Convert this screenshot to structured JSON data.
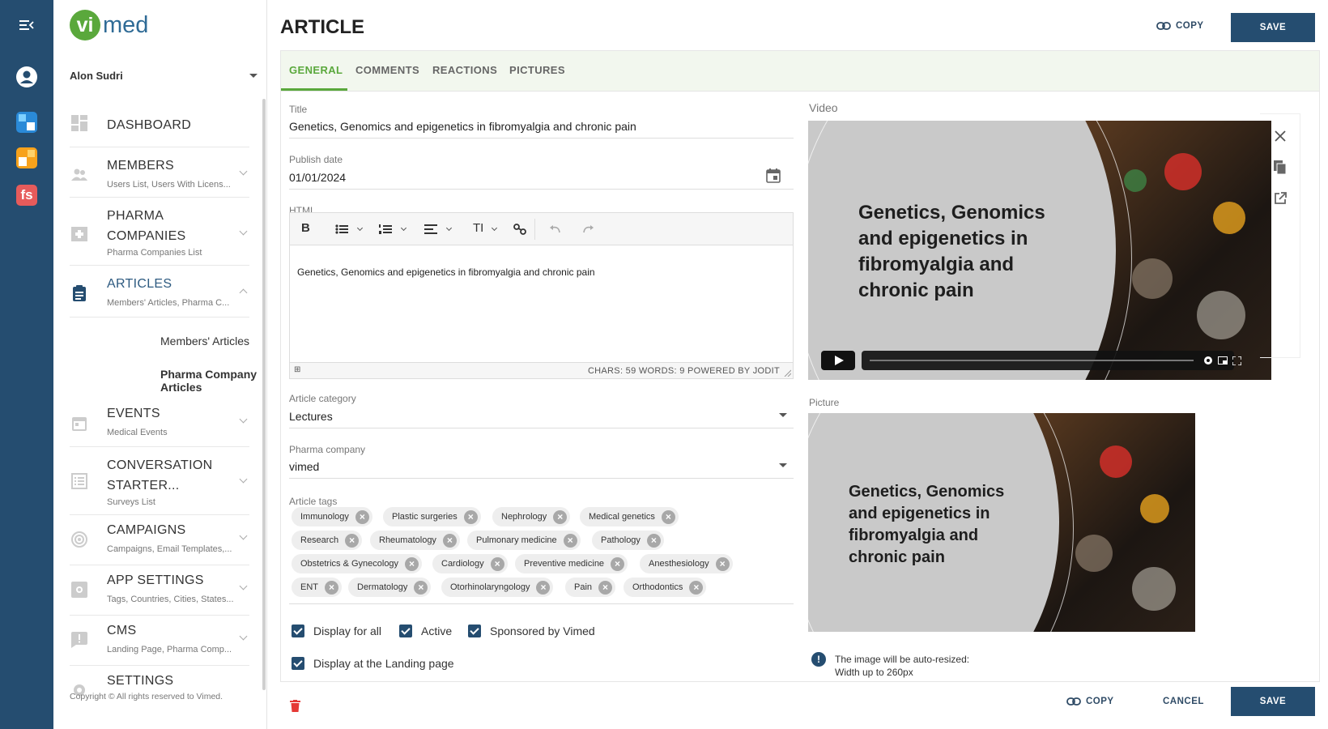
{
  "sidebar": {
    "logo_vi": "vi",
    "logo_med": "med",
    "user_name": "Alon Sudri",
    "items": [
      {
        "label": "DASHBOARD",
        "sub": "",
        "icon": "dashboard-icon"
      },
      {
        "label": "MEMBERS",
        "sub": "Users List, Users With Licens...",
        "icon": "people-icon"
      },
      {
        "label": "PHARMA COMPANIES",
        "sub": "Pharma Companies List",
        "icon": "pharma-icon"
      },
      {
        "label": "ARTICLES",
        "sub": "Members' Articles, Pharma C...",
        "icon": "clipboard-icon"
      },
      {
        "label": "EVENTS",
        "sub": "Medical Events",
        "icon": "calendar-icon"
      },
      {
        "label": "CONVERSATION STARTER...",
        "sub": "Surveys List",
        "icon": "list-icon"
      },
      {
        "label": "CAMPAIGNS",
        "sub": "Campaigns, Email Templates,...",
        "icon": "campaign-icon"
      },
      {
        "label": "APP SETTINGS",
        "sub": "Tags, Countries, Cities, States...",
        "icon": "settings-box-icon"
      },
      {
        "label": "CMS",
        "sub": "Landing Page, Pharma Comp...",
        "icon": "alert-box-icon"
      },
      {
        "label": "SETTINGS",
        "sub": "",
        "icon": "gear-icon"
      }
    ],
    "articles_sub": [
      "Members' Articles",
      "Pharma Company Articles"
    ],
    "copyright": "Copyright © All rights reserved to Vimed."
  },
  "header": {
    "title": "ARTICLE",
    "copy_label": "COPY",
    "save_label": "SAVE"
  },
  "tabs": [
    "GENERAL",
    "COMMENTS",
    "REACTIONS",
    "PICTURES"
  ],
  "form": {
    "title_label": "Title",
    "title_value": "Genetics, Genomics and epigenetics in fibromyalgia and chronic pain",
    "publish_label": "Publish date",
    "publish_value": "01/01/2024",
    "html_label": "HTML",
    "html_content": "Genetics, Genomics and epigenetics in fibromyalgia and chronic pain",
    "editor_status": "CHARS: 59   WORDS: 9   POWERED BY JODIT",
    "category_label": "Article category",
    "category_value": "Lectures",
    "pharma_label": "Pharma company",
    "pharma_value": "vimed",
    "tags_label": "Article tags",
    "tags": [
      [
        "Immunology",
        "Plastic surgeries",
        "Nephrology",
        "Medical genetics"
      ],
      [
        "Research",
        "Rheumatology",
        "Pulmonary medicine",
        "Pathology"
      ],
      [
        "Obstetrics & Gynecology",
        "Cardiology",
        "Preventive medicine",
        "Anesthesiology"
      ],
      [
        "ENT",
        "Dermatology",
        "Otorhinolaryngology",
        "Pain",
        "Orthodontics"
      ]
    ],
    "checkboxes": [
      "Display for all",
      "Active",
      "Sponsored by Vimed",
      "Display at the Landing page"
    ]
  },
  "video": {
    "label": "Video",
    "slide_text": "Genetics, Genomics and epigenetics in fibromyalgia and chronic pain"
  },
  "picture": {
    "label": "Picture",
    "slide_text": "Genetics, Genomics and epigenetics in fibromyalgia and chronic pain",
    "note_line1": "The image will be auto-resized:",
    "note_line2": "Width up to 260px"
  },
  "footer": {
    "copy_label": "COPY",
    "cancel_label": "CANCEL",
    "save_label": "SAVE"
  },
  "colors": {
    "rail": "#254d70",
    "accent_green": "#5aa83c",
    "primary": "#254d70"
  }
}
